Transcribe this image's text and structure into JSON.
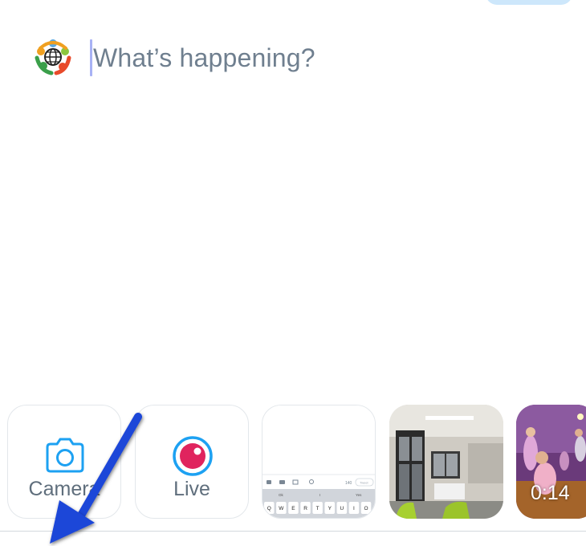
{
  "composer": {
    "placeholder": "What’s happening?"
  },
  "media_tray": {
    "camera_label": "Camera",
    "live_label": "Live",
    "video_duration": "0:14"
  },
  "keyboard_preview": {
    "counter": "140",
    "tweet_label": "Tweet",
    "keys": [
      "Q",
      "W",
      "E",
      "R",
      "T",
      "Y",
      "U",
      "I",
      "O"
    ]
  },
  "colors": {
    "accent_blue": "#1da1f2",
    "live_pink": "#e0245e",
    "placeholder_text": "#6f7f8f",
    "annotation_arrow": "#1f46d8"
  },
  "icons": [
    "avatar-logo",
    "camera-icon",
    "live-icon",
    "annotation-arrow"
  ]
}
